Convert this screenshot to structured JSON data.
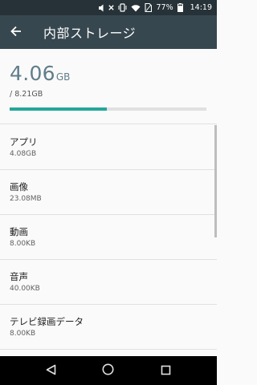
{
  "status_bar": {
    "battery_percent": "77%",
    "time": "14:19",
    "icons": [
      "mute-icon",
      "close-icon",
      "vibrate-icon",
      "wifi-icon",
      "no-sim-icon",
      "battery-icon"
    ]
  },
  "app_bar": {
    "title": "内部ストレージ",
    "back_icon": "arrow-left-icon"
  },
  "summary": {
    "used_value": "4.06",
    "used_unit": "GB",
    "total": "/ 8.21GB",
    "used_fraction": 0.494,
    "accent_color": "#26a69a"
  },
  "categories": [
    {
      "label": "アプリ",
      "size": "4.08GB"
    },
    {
      "label": "画像",
      "size": "23.08MB"
    },
    {
      "label": "動画",
      "size": "8.00KB"
    },
    {
      "label": "音声",
      "size": "40.00KB"
    },
    {
      "label": "テレビ録画データ",
      "size": "8.00KB"
    }
  ],
  "nav_bar": {
    "buttons": [
      "back-triangle-icon",
      "home-circle-icon",
      "recents-square-icon"
    ]
  }
}
